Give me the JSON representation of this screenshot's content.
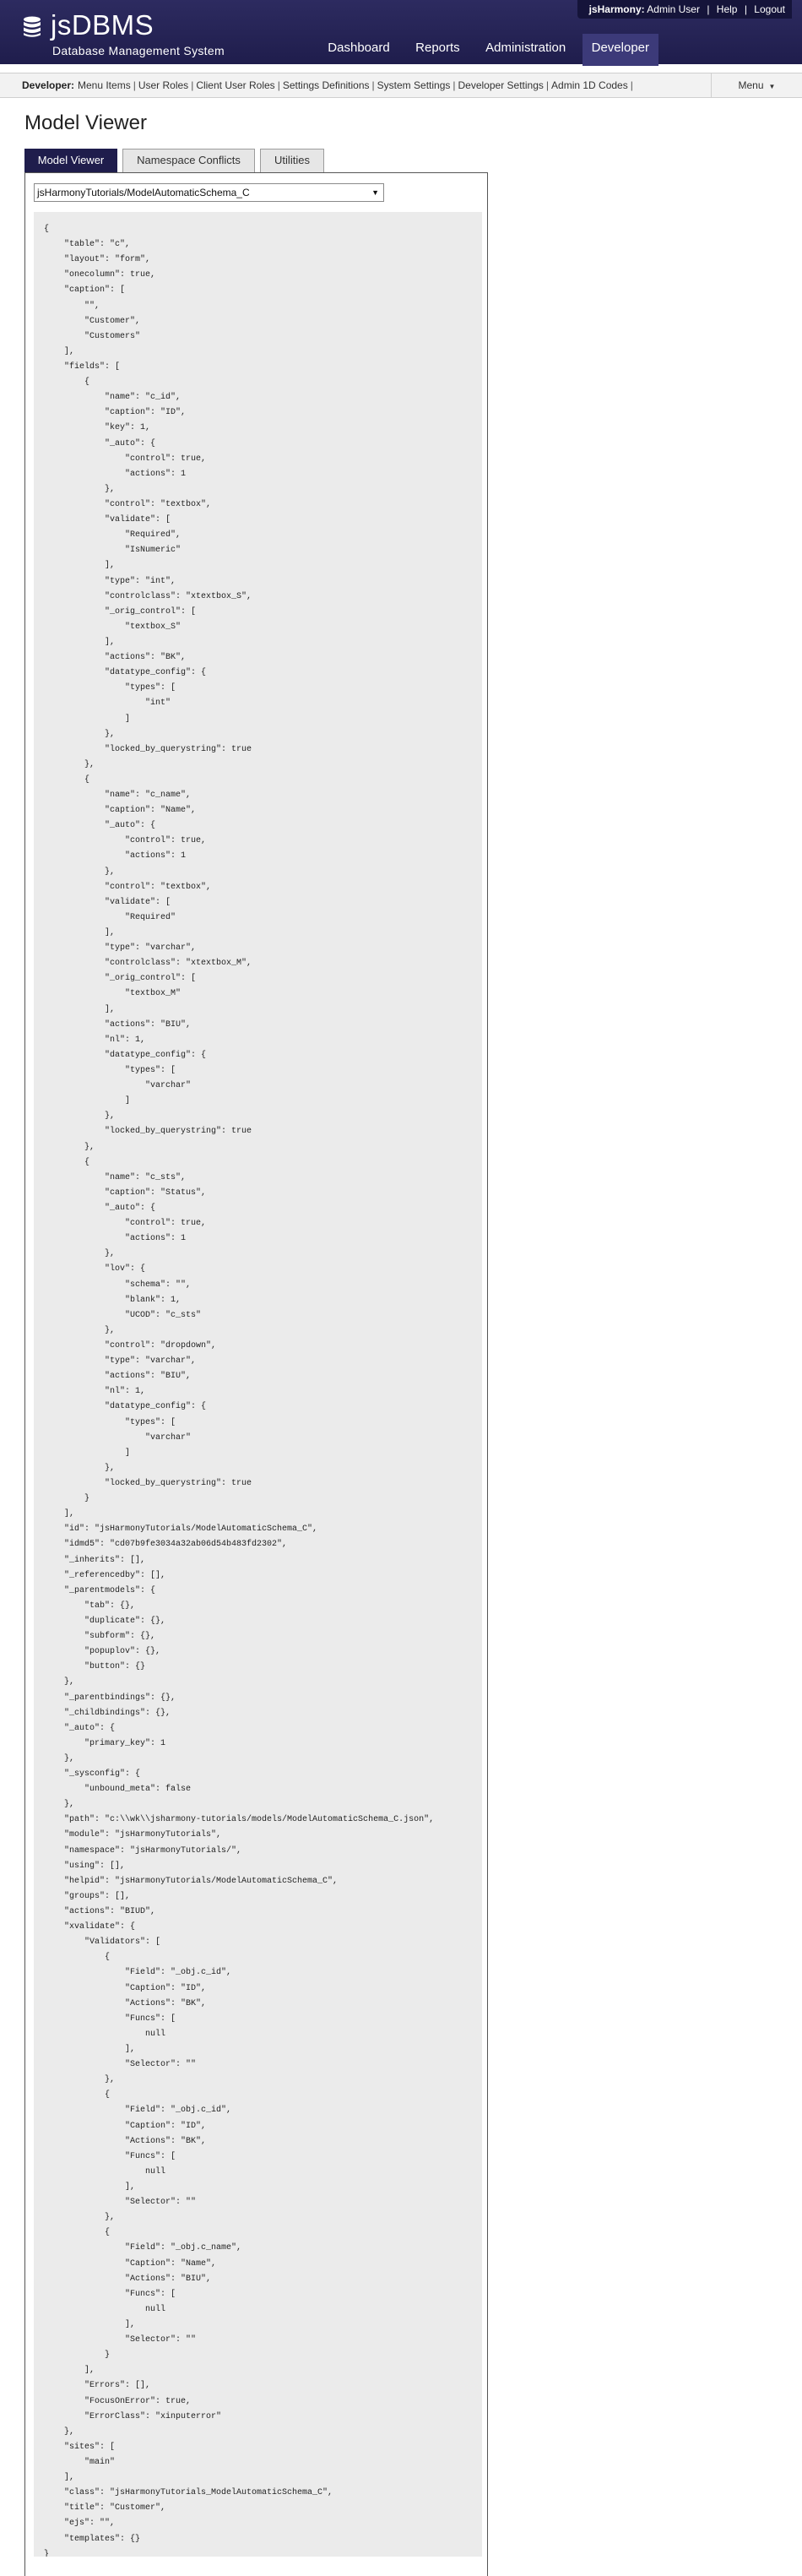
{
  "header": {
    "brand": "jsDBMS",
    "subtitle": "Database Management System",
    "user_label": "jsHarmony:",
    "user_name": "Admin User",
    "help_link": "Help",
    "logout_link": "Logout",
    "separator": "|",
    "nav": [
      {
        "label": "Dashboard"
      },
      {
        "label": "Reports"
      },
      {
        "label": "Administration"
      },
      {
        "label": "Developer"
      }
    ]
  },
  "subnav": {
    "label": "Developer:",
    "links": [
      {
        "label": "Menu Items"
      },
      {
        "label": "User Roles"
      },
      {
        "label": "Client User Roles"
      },
      {
        "label": "Settings Definitions"
      },
      {
        "label": "System Settings"
      },
      {
        "label": "Developer Settings"
      },
      {
        "label": "Admin 1D Codes"
      }
    ],
    "menu_label": "Menu"
  },
  "page": {
    "title": "Model Viewer",
    "tabs": [
      {
        "label": "Model Viewer",
        "active": true
      },
      {
        "label": "Namespace Conflicts",
        "active": false
      },
      {
        "label": "Utilities",
        "active": false
      }
    ],
    "selected_model": "jsHarmonyTutorials/ModelAutomaticSchema_C",
    "model_json": "{\n    \"table\": \"c\",\n    \"layout\": \"form\",\n    \"onecolumn\": true,\n    \"caption\": [\n        \"\",\n        \"Customer\",\n        \"Customers\"\n    ],\n    \"fields\": [\n        {\n            \"name\": \"c_id\",\n            \"caption\": \"ID\",\n            \"key\": 1,\n            \"_auto\": {\n                \"control\": true,\n                \"actions\": 1\n            },\n            \"control\": \"textbox\",\n            \"validate\": [\n                \"Required\",\n                \"IsNumeric\"\n            ],\n            \"type\": \"int\",\n            \"controlclass\": \"xtextbox_S\",\n            \"_orig_control\": [\n                \"textbox_S\"\n            ],\n            \"actions\": \"BK\",\n            \"datatype_config\": {\n                \"types\": [\n                    \"int\"\n                ]\n            },\n            \"locked_by_querystring\": true\n        },\n        {\n            \"name\": \"c_name\",\n            \"caption\": \"Name\",\n            \"_auto\": {\n                \"control\": true,\n                \"actions\": 1\n            },\n            \"control\": \"textbox\",\n            \"validate\": [\n                \"Required\"\n            ],\n            \"type\": \"varchar\",\n            \"controlclass\": \"xtextbox_M\",\n            \"_orig_control\": [\n                \"textbox_M\"\n            ],\n            \"actions\": \"BIU\",\n            \"nl\": 1,\n            \"datatype_config\": {\n                \"types\": [\n                    \"varchar\"\n                ]\n            },\n            \"locked_by_querystring\": true\n        },\n        {\n            \"name\": \"c_sts\",\n            \"caption\": \"Status\",\n            \"_auto\": {\n                \"control\": true,\n                \"actions\": 1\n            },\n            \"lov\": {\n                \"schema\": \"\",\n                \"blank\": 1,\n                \"UCOD\": \"c_sts\"\n            },\n            \"control\": \"dropdown\",\n            \"type\": \"varchar\",\n            \"actions\": \"BIU\",\n            \"nl\": 1,\n            \"datatype_config\": {\n                \"types\": [\n                    \"varchar\"\n                ]\n            },\n            \"locked_by_querystring\": true\n        }\n    ],\n    \"id\": \"jsHarmonyTutorials/ModelAutomaticSchema_C\",\n    \"idmd5\": \"cd07b9fe3034a32ab06d54b483fd2302\",\n    \"_inherits\": [],\n    \"_referencedby\": [],\n    \"_parentmodels\": {\n        \"tab\": {},\n        \"duplicate\": {},\n        \"subform\": {},\n        \"popuplov\": {},\n        \"button\": {}\n    },\n    \"_parentbindings\": {},\n    \"_childbindings\": {},\n    \"_auto\": {\n        \"primary_key\": 1\n    },\n    \"_sysconfig\": {\n        \"unbound_meta\": false\n    },\n    \"path\": \"c:\\\\wk\\\\jsharmony-tutorials/models/ModelAutomaticSchema_C.json\",\n    \"module\": \"jsHarmonyTutorials\",\n    \"namespace\": \"jsHarmonyTutorials/\",\n    \"using\": [],\n    \"helpid\": \"jsHarmonyTutorials/ModelAutomaticSchema_C\",\n    \"groups\": [],\n    \"actions\": \"BIUD\",\n    \"xvalidate\": {\n        \"Validators\": [\n            {\n                \"Field\": \"_obj.c_id\",\n                \"Caption\": \"ID\",\n                \"Actions\": \"BK\",\n                \"Funcs\": [\n                    null\n                ],\n                \"Selector\": \"\"\n            },\n            {\n                \"Field\": \"_obj.c_id\",\n                \"Caption\": \"ID\",\n                \"Actions\": \"BK\",\n                \"Funcs\": [\n                    null\n                ],\n                \"Selector\": \"\"\n            },\n            {\n                \"Field\": \"_obj.c_name\",\n                \"Caption\": \"Name\",\n                \"Actions\": \"BIU\",\n                \"Funcs\": [\n                    null\n                ],\n                \"Selector\": \"\"\n            }\n        ],\n        \"Errors\": [],\n        \"FocusOnError\": true,\n        \"ErrorClass\": \"xinputerror\"\n    },\n    \"sites\": [\n        \"main\"\n    ],\n    \"class\": \"jsHarmonyTutorials_ModelAutomaticSchema_C\",\n    \"title\": \"Customer\",\n    \"ejs\": \"\",\n    \"templates\": {}\n}"
  },
  "colors": {
    "header_bg": "#1f1d4c",
    "active_tab_bg": "#1f1d4c",
    "code_bg": "#ebebeb"
  },
  "icons": {
    "logo": "database-stack-icon",
    "menu_caret": "caret-down-icon",
    "select_arrow": "dropdown-arrow-icon"
  }
}
